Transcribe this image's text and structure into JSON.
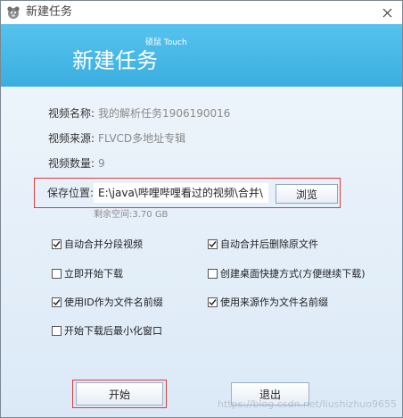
{
  "window": {
    "title": "新建任务",
    "close_glyph": "✕"
  },
  "banner": {
    "title": "新建任务",
    "subtitle": "硕鼠 Touch"
  },
  "info": {
    "name_label": "视频名称:",
    "name_value": "我的解析任务1906190016",
    "source_label": "视频来源:",
    "source_value": "FLVCD多地址专辑",
    "count_label": "视频数量:",
    "count_value": "9"
  },
  "save": {
    "label": "保存位置:",
    "path": "E:\\java\\哔哩哔哩看过的视频\\合并\\",
    "browse_label": "浏览",
    "remaining": "剩余空间:3.70 GB"
  },
  "options": [
    {
      "label": "自动合并分段视频",
      "checked": true
    },
    {
      "label": "自动合并后删除原文件",
      "checked": true
    },
    {
      "label": "立即开始下载",
      "checked": false
    },
    {
      "label": "创建桌面快捷方式(方便继续下载)",
      "checked": false
    },
    {
      "label": "使用ID作为文件名前缀",
      "checked": true
    },
    {
      "label": "使用来源作为文件名前缀",
      "checked": true
    },
    {
      "label": "开始下载后最小化窗口",
      "checked": false
    }
  ],
  "buttons": {
    "start": "开始",
    "exit": "退出"
  },
  "watermark": "https://blog.csdn.net/liushizhuo9655",
  "colors": {
    "banner": "#3aaee0",
    "highlight": "#e03b3b",
    "background": "#e7f0f9"
  },
  "icons": {
    "app": "app-icon",
    "close": "close-icon",
    "check": "checkmark-icon"
  }
}
